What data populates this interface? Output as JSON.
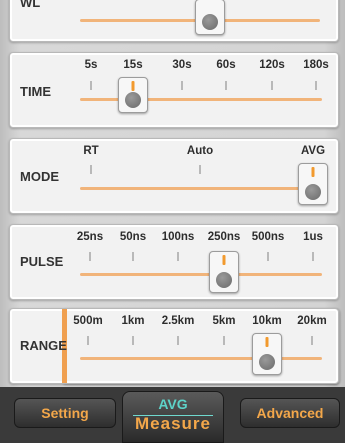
{
  "top_partial": {
    "label": "WL"
  },
  "time": {
    "label": "TIME",
    "options": [
      "5s",
      "15s",
      "30s",
      "60s",
      "120s",
      "180s"
    ],
    "selected": "15s"
  },
  "mode": {
    "label": "MODE",
    "options": [
      "RT",
      "Auto",
      "AVG"
    ],
    "selected": "AVG"
  },
  "pulse": {
    "label": "PULSE",
    "options": [
      "25ns",
      "50ns",
      "100ns",
      "250ns",
      "500ns",
      "1us"
    ],
    "selected": "250ns"
  },
  "range": {
    "label": "RANGE",
    "options": [
      "500m",
      "1km",
      "2.5km",
      "5km",
      "10km",
      "20km"
    ],
    "selected": "10km"
  },
  "tabs": {
    "left": "Setting",
    "center_mode": "AVG",
    "center": "Measure",
    "right": "Advanced"
  },
  "colors": {
    "accent": "#f29a2e",
    "teal": "#5dd3c9",
    "card": "#f2f2f2"
  }
}
